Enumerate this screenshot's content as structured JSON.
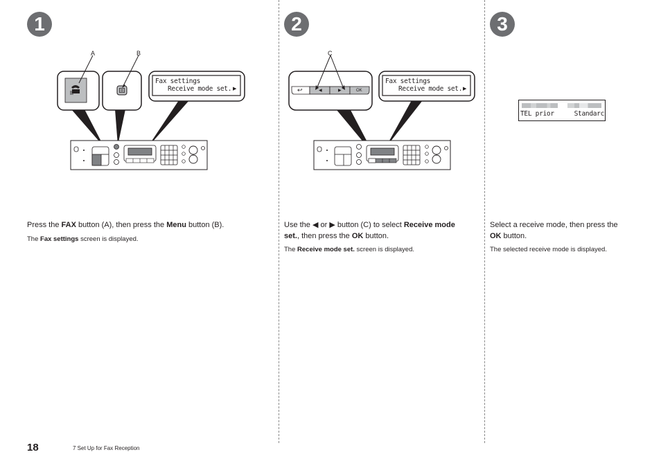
{
  "page": {
    "number": "18",
    "section": "7  Set Up for Fax Reception"
  },
  "steps": [
    {
      "badge": "1",
      "callouts": {
        "a": "A",
        "b": "B"
      },
      "lcd": {
        "line1": "Fax settings",
        "line2": "Receive mode set.",
        "arrow": "▶"
      },
      "instruction": {
        "t1": "Press the ",
        "b1": "FAX",
        "t2": " button (A), then press the ",
        "b2": "Menu",
        "t3": " button (B)."
      },
      "note": {
        "t1": "The ",
        "b1": "Fax settings",
        "t2": " screen is displayed."
      }
    },
    {
      "badge": "2",
      "callouts": {
        "c": "C"
      },
      "buttons": {
        "back": "↩",
        "left": "◀",
        "right": "▶",
        "ok": "OK"
      },
      "lcd": {
        "line1": "Fax settings",
        "line2": "Receive mode set.",
        "arrow": "▶"
      },
      "instruction": {
        "t1": "Use the ",
        "left_icon": "◀",
        "t2": " or ",
        "right_icon": "▶",
        "t3": " button (C) to select ",
        "b1": "Receive mode set.",
        "t4": ", then press the ",
        "b2": "OK",
        "t5": " button."
      },
      "note": {
        "t1": "The ",
        "b1": "Receive mode set.",
        "t2": " screen is displayed."
      }
    },
    {
      "badge": "3",
      "lcd": {
        "left": "TEL prior",
        "right": "Standarc"
      },
      "instruction": {
        "t1": "Select a receive mode, then press the ",
        "b1": "OK",
        "t2": " button."
      },
      "note": {
        "t1": "The selected receive mode is displayed."
      }
    }
  ],
  "colors": {
    "badge": "#6d6e71",
    "ink": "#231f20",
    "panel_fill": "#bcbec0",
    "highlight_fill": "#808285"
  }
}
